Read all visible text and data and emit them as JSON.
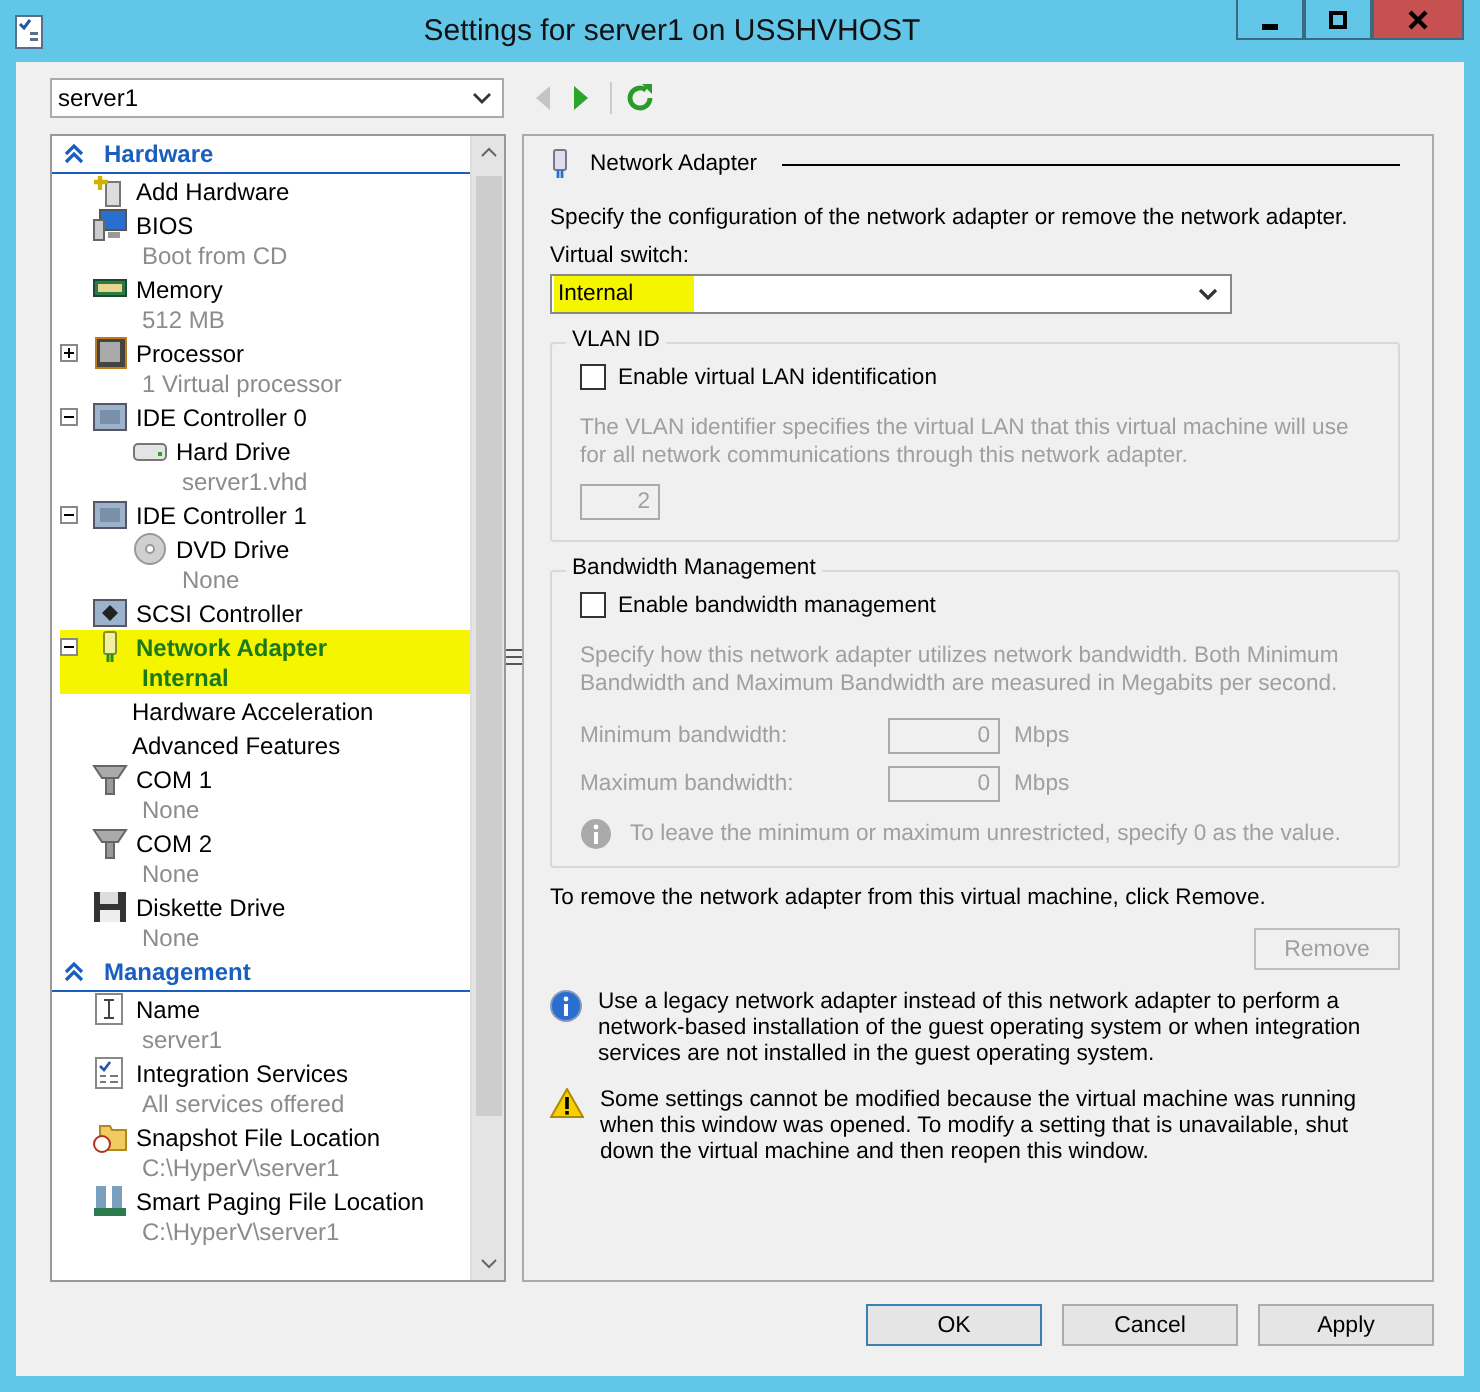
{
  "window": {
    "title": "Settings for server1 on USSHVHOST"
  },
  "vm_selector": {
    "value": "server1"
  },
  "nav_buttons": [
    {
      "kind": "back",
      "disabled": true
    },
    {
      "kind": "forward",
      "disabled": false
    },
    {
      "kind": "refresh",
      "disabled": false
    }
  ],
  "sidebar": {
    "sections": [
      {
        "title": "Hardware",
        "expanded": true,
        "items": [
          {
            "name": "Add Hardware",
            "selected": false
          },
          {
            "name": "BIOS",
            "detail": "Boot from CD",
            "selected": false
          },
          {
            "name": "Memory",
            "detail": "512 MB",
            "selected": false
          },
          {
            "name": "Processor",
            "detail": "1 Virtual processor",
            "expanded": false,
            "selected": false
          },
          {
            "name": "IDE Controller 0",
            "expanded": true,
            "selected": false,
            "children": [
              {
                "name": "Hard Drive",
                "detail": "server1.vhd",
                "selected": false
              }
            ]
          },
          {
            "name": "IDE Controller 1",
            "expanded": true,
            "selected": false,
            "children": [
              {
                "name": "DVD Drive",
                "detail": "None",
                "selected": false
              }
            ]
          },
          {
            "name": "SCSI Controller",
            "selected": false
          },
          {
            "name": "Network Adapter",
            "detail": "Internal",
            "expanded": true,
            "selected": true,
            "children": [
              {
                "name": "Hardware Acceleration",
                "selected": false
              },
              {
                "name": "Advanced Features",
                "selected": false
              }
            ]
          },
          {
            "name": "COM 1",
            "detail": "None",
            "selected": false
          },
          {
            "name": "COM 2",
            "detail": "None",
            "selected": false
          },
          {
            "name": "Diskette Drive",
            "detail": "None",
            "selected": false
          }
        ]
      },
      {
        "title": "Management",
        "expanded": true,
        "items": [
          {
            "name": "Name",
            "detail": "server1",
            "selected": false
          },
          {
            "name": "Integration Services",
            "detail": "All services offered",
            "selected": false
          },
          {
            "name": "Snapshot File Location",
            "detail": "C:\\HyperV\\server1",
            "selected": false
          },
          {
            "name": "Smart Paging File Location",
            "detail": "C:\\HyperV\\server1",
            "selected": false
          }
        ]
      }
    ]
  },
  "panel": {
    "title": "Network Adapter",
    "description": "Specify the configuration of the network adapter or remove the network adapter.",
    "switch_label": "Virtual switch:",
    "switch": {
      "value": "Internal",
      "highlighted": true
    },
    "vlan": {
      "title": "VLAN ID",
      "checkbox": {
        "label": "Enable virtual LAN identification",
        "checked": false
      },
      "description": "The VLAN identifier specifies the virtual LAN that this virtual machine will use for all network communications through this network adapter.",
      "value": "2",
      "disabled": true
    },
    "bandwidth": {
      "title": "Bandwidth Management",
      "checkbox": {
        "label": "Enable bandwidth management",
        "checked": false
      },
      "description": "Specify how this network adapter utilizes network bandwidth. Both Minimum Bandwidth and Maximum Bandwidth are measured in Megabits per second.",
      "disabled": true,
      "fields": [
        {
          "label": "Minimum bandwidth:",
          "value": "0",
          "unit": "Mbps"
        },
        {
          "label": "Maximum bandwidth:",
          "value": "0",
          "unit": "Mbps"
        }
      ],
      "note": "To leave the minimum or maximum unrestricted, specify 0 as the value."
    },
    "remove_text": "To remove the network adapter from this virtual machine, click Remove.",
    "remove_button": {
      "label": "Remove",
      "disabled": true
    },
    "notes": [
      {
        "kind": "info",
        "text": "Use a legacy network adapter instead of this network adapter to perform a network-based installation of the guest operating system or when integration services are not installed in the guest operating system."
      },
      {
        "kind": "warning",
        "text": "Some settings cannot be modified because the virtual machine was running when this window was opened. To modify a setting that is unavailable, shut down the virtual machine and then reopen this window."
      }
    ]
  },
  "buttons": [
    {
      "label": "OK",
      "default": true
    },
    {
      "label": "Cancel",
      "default": false
    },
    {
      "label": "Apply",
      "default": false
    }
  ]
}
